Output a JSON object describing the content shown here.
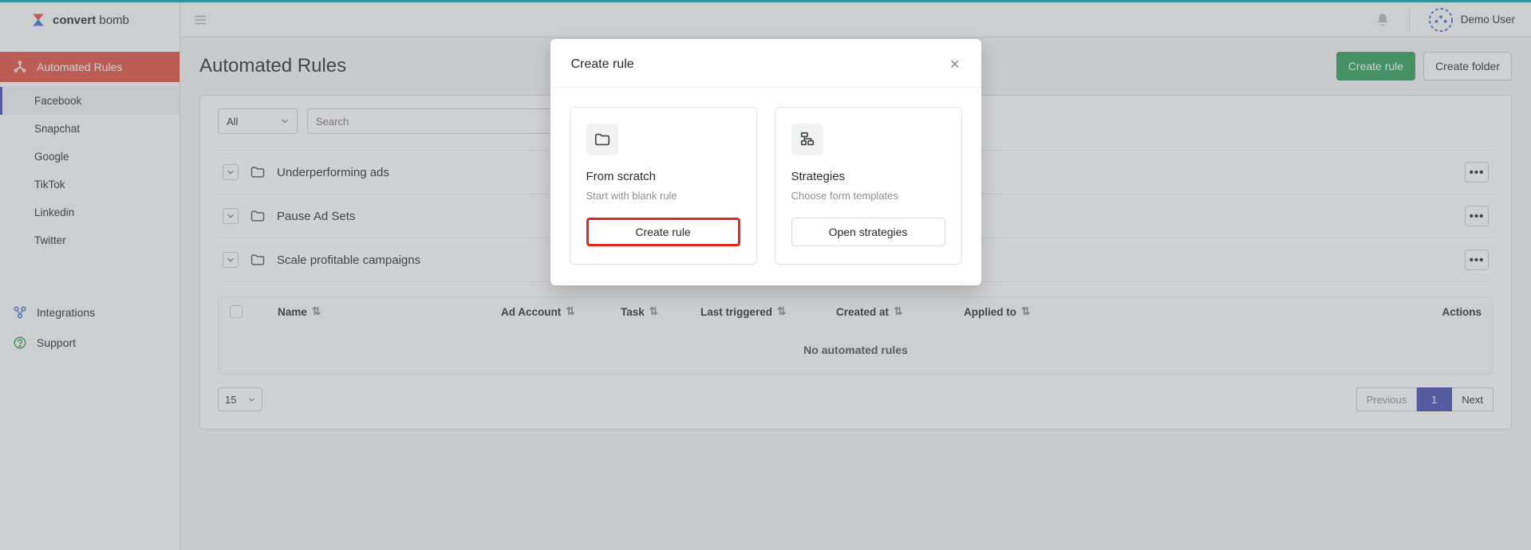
{
  "brand": {
    "bold": "convert",
    "light": " bomb"
  },
  "user": {
    "name": "Demo User"
  },
  "sidebar": {
    "active_label": "Automated Rules",
    "channels": [
      {
        "label": "Facebook",
        "active": true
      },
      {
        "label": "Snapchat"
      },
      {
        "label": "Google"
      },
      {
        "label": "TikTok"
      },
      {
        "label": "Linkedin"
      },
      {
        "label": "Twitter"
      }
    ],
    "links": [
      {
        "label": "Integrations",
        "icon_color": "#3871d1"
      },
      {
        "label": "Support",
        "icon_color": "#2a9d56"
      }
    ]
  },
  "page": {
    "title": "Automated Rules",
    "create_rule": "Create rule",
    "create_folder": "Create folder",
    "filter_all": "All",
    "search_placeholder": "Search",
    "folders": [
      {
        "name": "Underperforming ads"
      },
      {
        "name": "Pause Ad Sets"
      },
      {
        "name": "Scale profitable campaigns"
      }
    ],
    "columns": {
      "name": "Name",
      "ad_account": "Ad Account",
      "task": "Task",
      "last_triggered": "Last triggered",
      "created_at": "Created at",
      "applied_to": "Applied to",
      "actions": "Actions"
    },
    "empty_text": "No automated rules",
    "page_size": "15",
    "pager": {
      "prev": "Previous",
      "current": "1",
      "next": "Next"
    }
  },
  "modal": {
    "title": "Create rule",
    "scratch": {
      "title": "From scratch",
      "sub": "Start with blank rule",
      "button": "Create rule"
    },
    "strategies": {
      "title": "Strategies",
      "sub": "Choose form templates",
      "button": "Open strategies"
    }
  }
}
